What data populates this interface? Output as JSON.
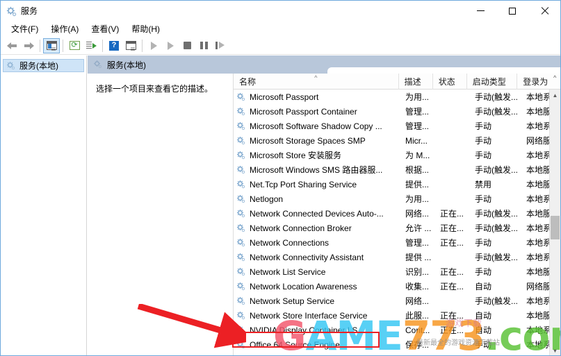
{
  "window": {
    "title": "服务",
    "icon": "services-gear-icon",
    "minimize_label": "最小化",
    "maximize_label": "最大化",
    "close_label": "关闭"
  },
  "menubar": {
    "items": [
      {
        "label": "文件(F)",
        "name": "menu-file"
      },
      {
        "label": "操作(A)",
        "name": "menu-action"
      },
      {
        "label": "查看(V)",
        "name": "menu-view"
      },
      {
        "label": "帮助(H)",
        "name": "menu-help"
      }
    ]
  },
  "toolbar": {
    "back": "后退",
    "forward": "前进",
    "show_tree": "显示/隐藏控制台树",
    "refresh": "刷新",
    "export": "导出列表",
    "help": "帮助",
    "properties": "属性",
    "start": "启动服务",
    "resume": "继续服务",
    "stop": "停止服务",
    "pause": "暂停服务",
    "restart": "重启动服务",
    "help_glyph": "?"
  },
  "sidebar": {
    "items": [
      {
        "label": "服务(本地)",
        "name": "sidebar-item-services-local",
        "selected": true
      }
    ]
  },
  "pane": {
    "header_title": "服务(本地)",
    "description_placeholder": "选择一个项目来查看它的描述。"
  },
  "columns": [
    {
      "key": "name",
      "label": "名称",
      "sorted": true
    },
    {
      "key": "desc",
      "label": "描述",
      "sorted": false
    },
    {
      "key": "state",
      "label": "状态",
      "sorted": false
    },
    {
      "key": "start",
      "label": "启动类型",
      "sorted": false
    },
    {
      "key": "logon",
      "label": "登录为",
      "sorted": false
    }
  ],
  "sort_indicator": "^",
  "scroll_up_glyph": "▲",
  "scroll_down_glyph": "▼",
  "rows": [
    {
      "name": "Microsoft Passport",
      "desc": "为用...",
      "state": "",
      "start": "手动(触发...",
      "logon": "本地系"
    },
    {
      "name": "Microsoft Passport Container",
      "desc": "管理...",
      "state": "",
      "start": "手动(触发...",
      "logon": "本地服"
    },
    {
      "name": "Microsoft Software Shadow Copy ...",
      "desc": "管理...",
      "state": "",
      "start": "手动",
      "logon": "本地系"
    },
    {
      "name": "Microsoft Storage Spaces SMP",
      "desc": "Micr...",
      "state": "",
      "start": "手动",
      "logon": "网络服"
    },
    {
      "name": "Microsoft Store 安装服务",
      "desc": "为 M...",
      "state": "",
      "start": "手动",
      "logon": "本地系"
    },
    {
      "name": "Microsoft Windows SMS 路由器服...",
      "desc": "根据...",
      "state": "",
      "start": "手动(触发...",
      "logon": "本地服"
    },
    {
      "name": "Net.Tcp Port Sharing Service",
      "desc": "提供...",
      "state": "",
      "start": "禁用",
      "logon": "本地服"
    },
    {
      "name": "Netlogon",
      "desc": "为用...",
      "state": "",
      "start": "手动",
      "logon": "本地系"
    },
    {
      "name": "Network Connected Devices Auto-...",
      "desc": "网络...",
      "state": "正在...",
      "start": "手动(触发...",
      "logon": "本地服"
    },
    {
      "name": "Network Connection Broker",
      "desc": "允许 ...",
      "state": "正在...",
      "start": "手动(触发...",
      "logon": "本地系"
    },
    {
      "name": "Network Connections",
      "desc": "管理...",
      "state": "正在...",
      "start": "手动",
      "logon": "本地系"
    },
    {
      "name": "Network Connectivity Assistant",
      "desc": "提供 ...",
      "state": "",
      "start": "手动(触发...",
      "logon": "本地系"
    },
    {
      "name": "Network List Service",
      "desc": "识别...",
      "state": "正在...",
      "start": "手动",
      "logon": "本地服"
    },
    {
      "name": "Network Location Awareness",
      "desc": "收集...",
      "state": "正在...",
      "start": "自动",
      "logon": "网络服"
    },
    {
      "name": "Network Setup Service",
      "desc": "网络...",
      "state": "",
      "start": "手动(触发...",
      "logon": "本地系"
    },
    {
      "name": "Network Store Interface Service",
      "desc": "此服...",
      "state": "正在...",
      "start": "自动",
      "logon": "本地服"
    },
    {
      "name": "NVIDIA Display Container LS",
      "desc": "Cont...",
      "state": "正在...",
      "start": "自动",
      "logon": "本地系"
    },
    {
      "name": "Office 64 Source Engine",
      "desc": "保存...",
      "state": "",
      "start": "手动",
      "logon": "本地系"
    }
  ],
  "annotation": {
    "highlight_row_index": 16,
    "highlight_color": "#ec2024",
    "arrow_color": "#ec2024"
  },
  "watermark": {
    "part_g": "G",
    "part_ame": "AME",
    "part_773": "773",
    "part_com": ".com",
    "color_g": "#f4556b",
    "color_ame": "#34c6f4",
    "color_773": "#f7941e",
    "color_com": "#58c234",
    "sub_text": "游戏下载",
    "sub_text2": "最新最全的游戏资源下载站"
  }
}
